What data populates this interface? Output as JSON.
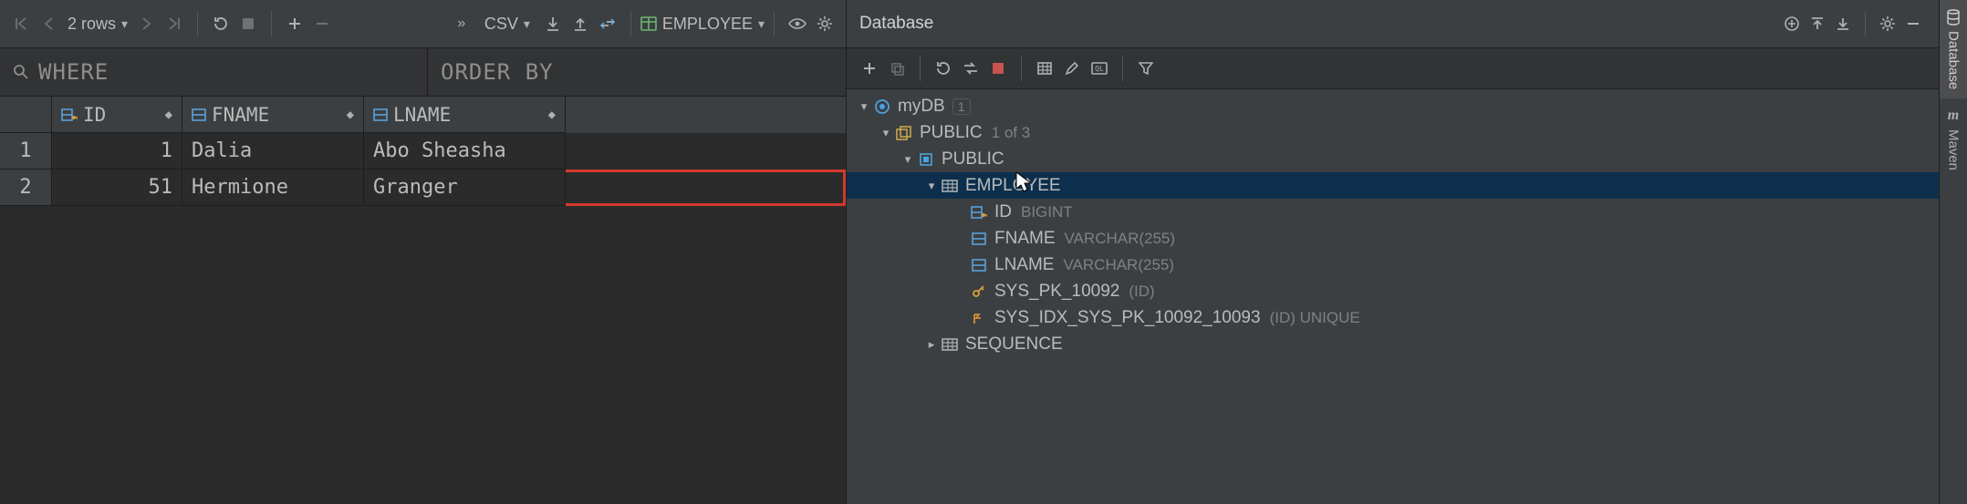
{
  "toolbar": {
    "rows_label": "2 rows",
    "export_format": "CSV",
    "table_selector": "EMPLOYEE"
  },
  "filters": {
    "where_placeholder": "WHERE",
    "order_placeholder": "ORDER BY"
  },
  "grid": {
    "columns": {
      "id": "ID",
      "fname": "FNAME",
      "lname": "LNAME"
    },
    "rows": [
      {
        "n": "1",
        "id": "1",
        "fname": "Dalia",
        "lname": "Abo Sheasha"
      },
      {
        "n": "2",
        "id": "51",
        "fname": "Hermione",
        "lname": "Granger"
      }
    ]
  },
  "db_panel": {
    "title": "Database",
    "tree": {
      "root": {
        "label": "myDB",
        "badge": "1"
      },
      "schema_group": {
        "label": "PUBLIC",
        "badge": "1 of 3"
      },
      "schema": {
        "label": "PUBLIC"
      },
      "table": {
        "label": "EMPLOYEE"
      },
      "columns": [
        {
          "name": "ID",
          "type": "BIGINT",
          "icon": "key-column"
        },
        {
          "name": "FNAME",
          "type": "VARCHAR(255)",
          "icon": "column"
        },
        {
          "name": "LNAME",
          "type": "VARCHAR(255)",
          "icon": "column"
        }
      ],
      "keys": [
        {
          "name": "SYS_PK_10092",
          "detail": "(ID)",
          "icon": "pk"
        },
        {
          "name": "SYS_IDX_SYS_PK_10092_10093",
          "detail": "(ID) UNIQUE",
          "icon": "index"
        }
      ],
      "sequence": {
        "label": "SEQUENCE"
      }
    }
  },
  "rail": {
    "database": "Database",
    "maven": "Maven"
  }
}
